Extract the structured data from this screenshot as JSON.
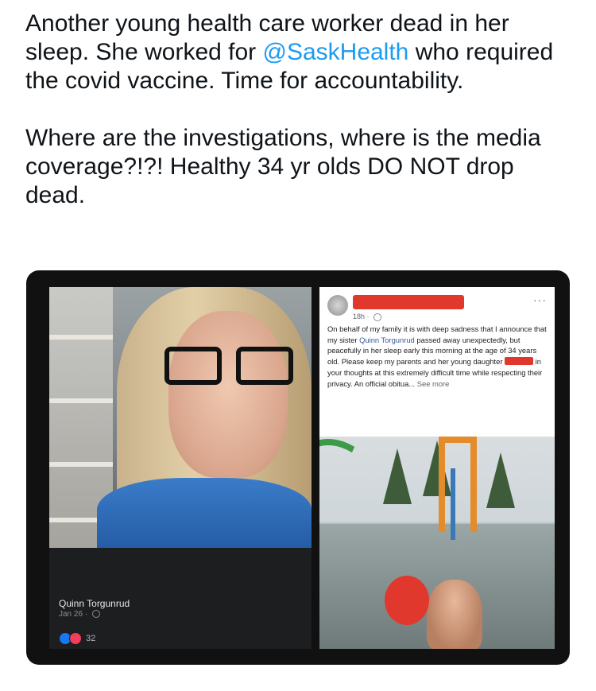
{
  "tweet": {
    "text_before": "Another young health care worker dead in her sleep. She worked for ",
    "mention": "@SaskHealth",
    "text_after": " who required the covid vaccine. Time for accountability.\n\nWhere are the investigations, where is the media coverage?!?! Healthy 34 yr olds DO NOT drop dead."
  },
  "left_post": {
    "name": "Quinn Torgunrud",
    "date": "Jan 26 · ",
    "reaction_count": "32"
  },
  "right_post": {
    "time": "18h · ",
    "body_1": "On behalf of my family it is with deep sadness that I announce that my sister ",
    "name_link": "Quinn Torgunrud",
    "body_2": " passed away unexpectedly, but peacefully in her sleep early this morning at the age of 34 years old. Please keep my parents and her young daughter ",
    "body_3": " in your thoughts at this extremely difficult time while respecting their privacy. An official obitua... ",
    "see_more": "See more",
    "more": "···"
  },
  "colors": {
    "mention": "#1d9bf0",
    "redaction": "#e0382d",
    "fb_dark": "#1d1e20"
  }
}
